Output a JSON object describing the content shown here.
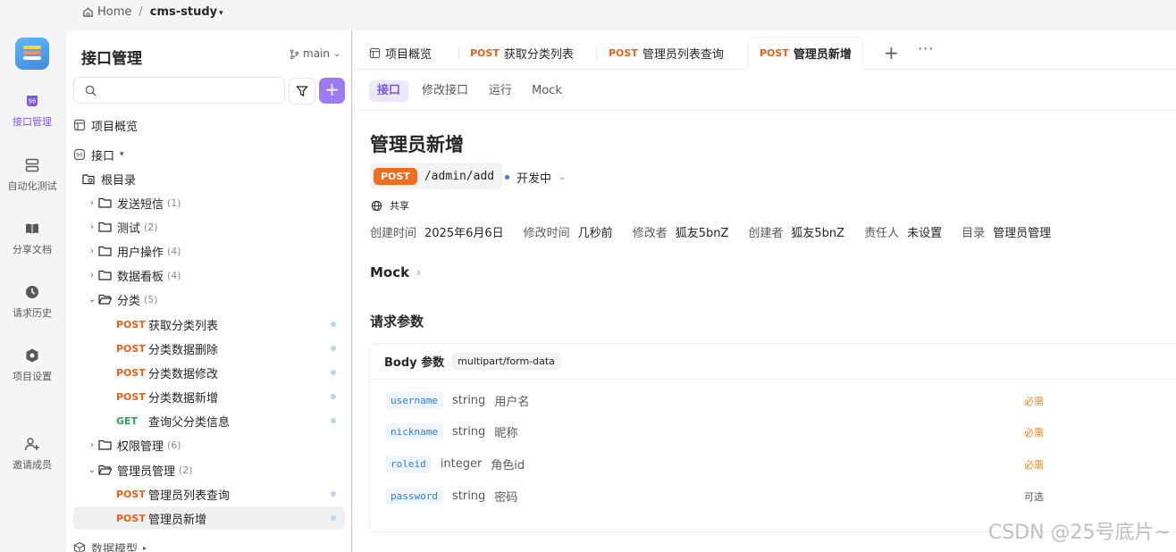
{
  "breadcrumb": {
    "home": "Home",
    "separator": "/",
    "project": "cms-study"
  },
  "rail": {
    "items": [
      {
        "label": "接口管理",
        "icon": "api-icon",
        "active": true
      },
      {
        "label": "自动化测试",
        "icon": "automation-icon"
      },
      {
        "label": "分享文档",
        "icon": "book-icon"
      },
      {
        "label": "请求历史",
        "icon": "clock-icon"
      },
      {
        "label": "项目设置",
        "icon": "settings-icon"
      },
      {
        "label": "邀请成员",
        "icon": "add-user-icon"
      }
    ]
  },
  "panel": {
    "title": "接口管理",
    "branch": "main",
    "search": {
      "placeholder": ""
    },
    "overview": "项目概览",
    "api_root": "接口",
    "root_dir": "根目录",
    "folders": [
      {
        "label": "发送短信",
        "count": "(1)"
      },
      {
        "label": "测试",
        "count": "(2)"
      },
      {
        "label": "用户操作",
        "count": "(4)"
      },
      {
        "label": "数据看板",
        "count": "(4)"
      },
      {
        "label": "分类",
        "count": "(5)"
      },
      {
        "label": "权限管理",
        "count": "(6)"
      },
      {
        "label": "管理员管理",
        "count": "(2)"
      }
    ],
    "category_items": [
      {
        "method": "POST",
        "label": "获取分类列表"
      },
      {
        "method": "POST",
        "label": "分类数据删除"
      },
      {
        "method": "POST",
        "label": "分类数据修改"
      },
      {
        "method": "POST",
        "label": "分类数据新增"
      },
      {
        "method": "GET",
        "label": "查询父分类信息"
      }
    ],
    "admin_items": [
      {
        "method": "POST",
        "label": "管理员列表查询"
      },
      {
        "method": "POST",
        "label": "管理员新增"
      }
    ],
    "data_model": "数据模型"
  },
  "tabs": [
    {
      "method": "",
      "label": "项目概览"
    },
    {
      "method": "POST",
      "label": "获取分类列表"
    },
    {
      "method": "POST",
      "label": "管理员列表查询"
    },
    {
      "method": "POST",
      "label": "管理员新增",
      "active": true
    }
  ],
  "subtabs": [
    "接口",
    "修改接口",
    "运行",
    "Mock"
  ],
  "api": {
    "title": "管理员新增",
    "method": "POST",
    "path": "/admin/add",
    "status": "开发中",
    "share": "共享",
    "meta": [
      {
        "k": "创建时间",
        "v": "2025年6月6日"
      },
      {
        "k": "修改时间",
        "v": "几秒前"
      },
      {
        "k": "修改者",
        "v": "狐友5bnZ"
      },
      {
        "k": "创建者",
        "v": "狐友5bnZ"
      },
      {
        "k": "责任人",
        "v": "未设置"
      },
      {
        "k": "目录",
        "v": "管理员管理"
      }
    ],
    "mock": "Mock",
    "params_title": "请求参数",
    "body_label": "Body 参数",
    "content_type": "multipart/form-data",
    "params": [
      {
        "name": "username",
        "type": "string",
        "desc": "用户名",
        "req": "必需"
      },
      {
        "name": "nickname",
        "type": "string",
        "desc": "昵称",
        "req": "必需"
      },
      {
        "name": "roleid",
        "type": "integer",
        "desc": "角色id",
        "req": "必需"
      },
      {
        "name": "password",
        "type": "string",
        "desc": "密码",
        "req": "可选"
      }
    ]
  },
  "watermark": "CSDN @25号底片~"
}
